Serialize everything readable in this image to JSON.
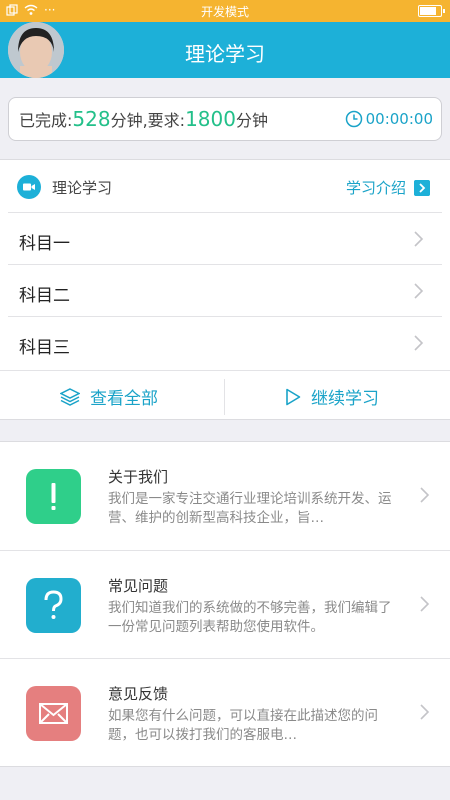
{
  "status_bar": {
    "title": "开发模式",
    "battery_level": 0.85
  },
  "navbar": {
    "title": "理论学习"
  },
  "progress": {
    "completed_label": "已完成:",
    "completed_minutes": "528",
    "unit1": "分钟,要求:",
    "required_minutes": "1800",
    "unit2": "分钟",
    "timer": "00:00:00"
  },
  "study": {
    "header_label": "理论学习",
    "intro_link": "学习介绍",
    "subjects": [
      {
        "name": "科目一"
      },
      {
        "name": "科目二"
      },
      {
        "name": "科目三"
      }
    ],
    "view_all": "查看全部",
    "continue": "继续学习"
  },
  "info": [
    {
      "title": "关于我们",
      "desc": "我们是一家专注交通行业理论培训系统开发、运营、维护的创新型高科技企业，旨…",
      "icon": "exclamation-icon",
      "color": "#2fcf8a"
    },
    {
      "title": "常见问题",
      "desc": "我们知道我们的系统做的不够完善，我们编辑了一份常见问题列表帮助您使用软件。",
      "icon": "question-icon",
      "color": "#22aece"
    },
    {
      "title": "意见反馈",
      "desc": "如果您有什么问题，可以直接在此描述您的问题，也可以拨打我们的客服电…",
      "icon": "mail-icon",
      "color": "#e57f7f"
    }
  ],
  "colors": {
    "status_bar": "#f5b430",
    "navbar": "#1db0d8",
    "accent": "#1aa3c8",
    "green": "#23c08a"
  }
}
